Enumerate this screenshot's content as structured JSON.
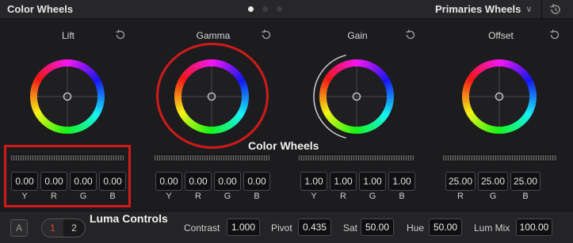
{
  "header": {
    "title": "Color Wheels",
    "mode": "Primaries Wheels"
  },
  "wheels": [
    {
      "label": "Lift",
      "values": [
        "0.00",
        "0.00",
        "0.00",
        "0.00"
      ],
      "channels": [
        "Y",
        "R",
        "G",
        "B"
      ]
    },
    {
      "label": "Gamma",
      "values": [
        "0.00",
        "0.00",
        "0.00",
        "0.00"
      ],
      "channels": [
        "Y",
        "R",
        "G",
        "B"
      ]
    },
    {
      "label": "Gain",
      "values": [
        "1.00",
        "1.00",
        "1.00",
        "1.00"
      ],
      "channels": [
        "Y",
        "R",
        "G",
        "B"
      ]
    },
    {
      "label": "Offset",
      "values": [
        "25.00",
        "25.00",
        "25.00"
      ],
      "channels": [
        "R",
        "G",
        "B"
      ]
    }
  ],
  "annotations": {
    "color_wheels": "Color Wheels",
    "luma_controls": "Luma Controls"
  },
  "footer": {
    "a_button": "A",
    "page_1": "1",
    "page_2": "2",
    "contrast_label": "Contrast",
    "contrast_value": "1.000",
    "pivot_label": "Pivot",
    "pivot_value": "0.435",
    "sat_label": "Sat",
    "sat_value": "50.00",
    "hue_label": "Hue",
    "hue_value": "50.00",
    "lum_mix_label": "Lum Mix",
    "lum_mix_value": "100.00"
  },
  "colors": {
    "annotation": "#d11a1a",
    "active_page": "#e04040",
    "background": "#1c1c1f"
  },
  "icons": [
    "reset-icon",
    "history-icon",
    "chevron-down-icon"
  ]
}
